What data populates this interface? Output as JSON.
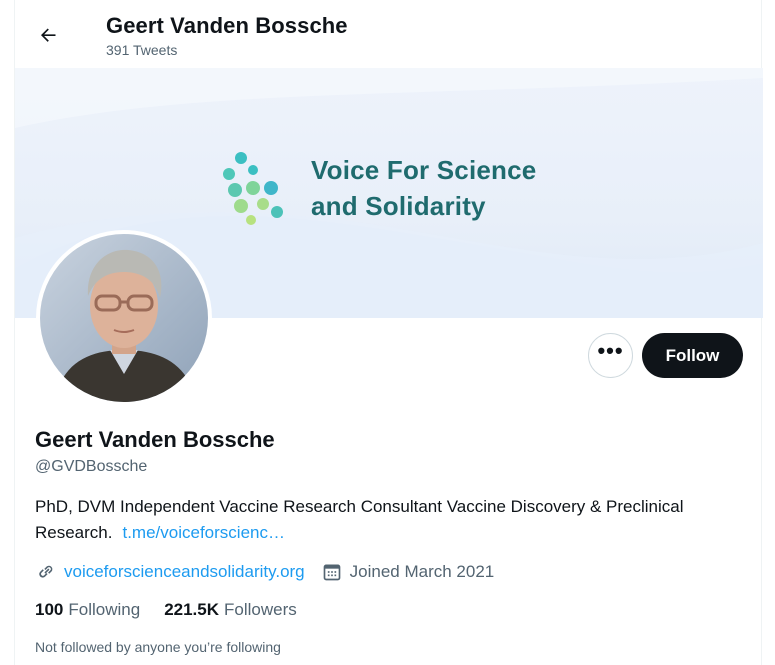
{
  "header": {
    "title": "Geert Vanden Bossche",
    "tweet_count": "391 Tweets",
    "back_icon": "arrow-left-icon"
  },
  "banner": {
    "line1": "Voice For Science",
    "line2": "and Solidarity",
    "text_color": "#1f6b6e"
  },
  "profile": {
    "name": "Geert Vanden Bossche",
    "handle": "@GVDBossche",
    "bio": "PhD, DVM Independent Vaccine Research Consultant Vaccine Discovery & Preclinical Research.",
    "bio_link": "t.me/voiceforscienc…",
    "website": "voiceforscienceandsolidarity.org",
    "joined": "Joined March 2021"
  },
  "actions": {
    "more_label": "•••",
    "follow_label": "Follow"
  },
  "stats": {
    "following_count": "100",
    "following_label": "Following",
    "followers_count": "221.5K",
    "followers_label": "Followers"
  },
  "footer": {
    "not_followed": "Not followed by anyone you’re following"
  },
  "colors": {
    "link": "#1d9bf0",
    "muted": "#536471",
    "text": "#0f1419"
  }
}
